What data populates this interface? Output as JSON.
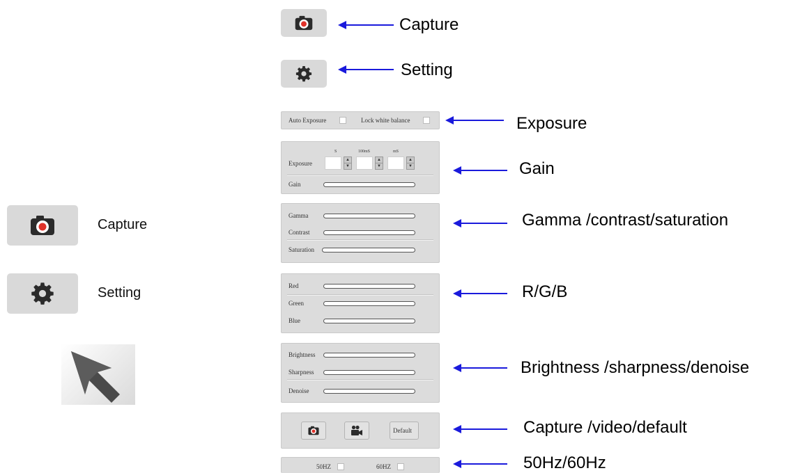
{
  "legend": {
    "capture_label": "Capture",
    "setting_label": "Setting"
  },
  "toolbar": {
    "capture_icon": "camera-icon",
    "setting_icon": "gear-icon"
  },
  "exposure_panel": {
    "auto_exposure_label": "Auto Exposure",
    "lock_white_balance_label": "Lock white balance"
  },
  "gain_panel": {
    "unit_s": "S",
    "unit_100ms": "100mS",
    "unit_ms": "mS",
    "exposure_label": "Exposure",
    "gain_label": "Gain"
  },
  "gamma_panel": {
    "gamma_label": "Gamma",
    "contrast_label": "Contrast",
    "saturation_label": "Saturation"
  },
  "rgb_panel": {
    "red_label": "Red",
    "green_label": "Green",
    "blue_label": "Blue"
  },
  "image_panel": {
    "brightness_label": "Brightness",
    "sharpness_label": "Sharpness",
    "denoise_label": "Denoise"
  },
  "action_panel": {
    "default_label": "Default"
  },
  "freq_panel": {
    "hz50_label": "50HZ",
    "hz60_label": "60HZ"
  },
  "annotations": {
    "capture": "Capture",
    "setting": "Setting",
    "exposure": "Exposure",
    "gain": "Gain",
    "gamma": "Gamma /contrast/saturation",
    "rgb": "R/G/B",
    "brightness": "Brightness /sharpness/denoise",
    "actions": "Capture /video/default",
    "freq": "50Hz/60Hz"
  },
  "colors": {
    "arrow": "#1a1adc",
    "record_dot": "#e0322a",
    "panel": "#dcdcdc"
  }
}
